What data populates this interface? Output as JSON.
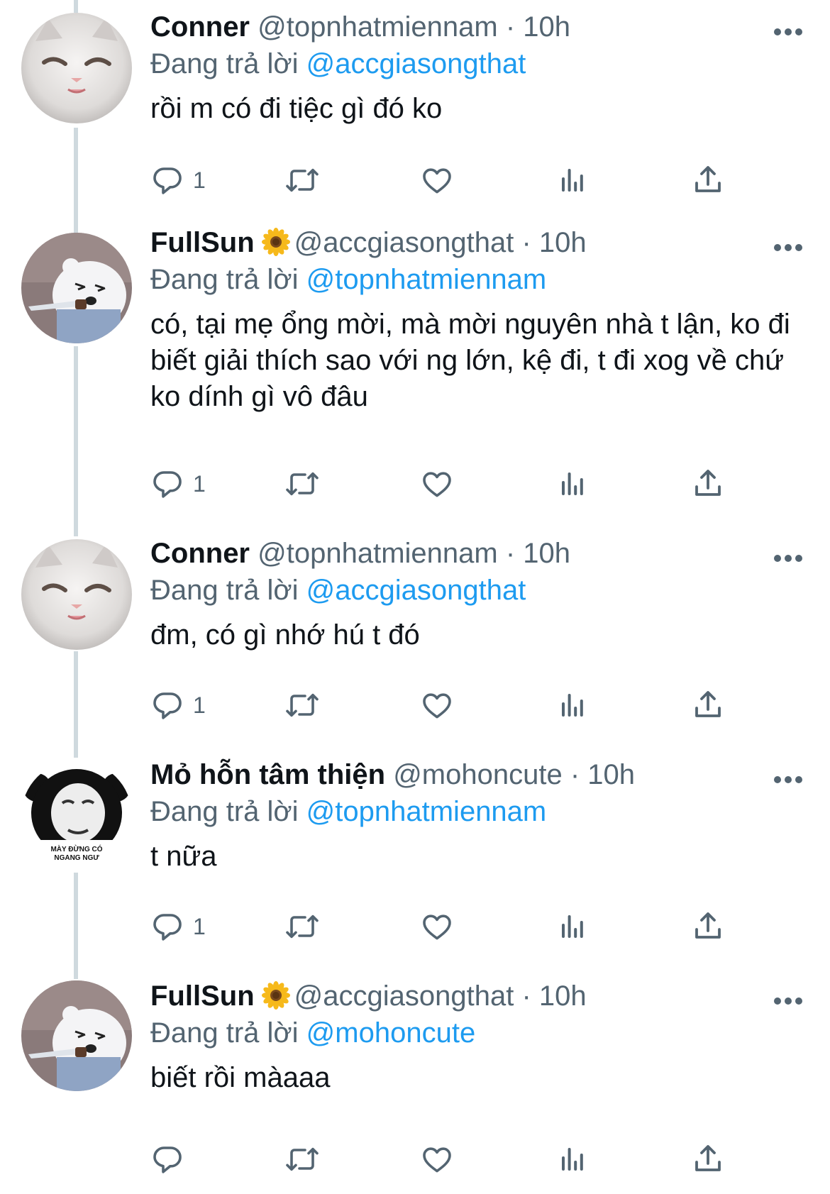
{
  "colors": {
    "text": "#0f1419",
    "secondary": "#536471",
    "accent": "#1d9bf0",
    "thread_line": "#cfd9de"
  },
  "tweets": [
    {
      "avatar": "white-cat-avatar",
      "name": "Conner",
      "handle": "@topnhatmiennam",
      "separator": "·",
      "time": "10h",
      "has_emoji": false,
      "replying_prefix": "Đang trả lời",
      "replying_to": "@accgiasongthat",
      "text": "rồi m có đi tiệc gì đó ko",
      "reply_count": "1"
    },
    {
      "avatar": "bear-knife-avatar",
      "name": "FullSun",
      "emoji": "sunflower-emoji",
      "handle": "@accgiasongthat",
      "separator": "·",
      "time": "10h",
      "has_emoji": true,
      "replying_prefix": "Đang trả lời",
      "replying_to": "@topnhatmiennam",
      "text": "có, tại mẹ ổng mời, mà mời nguyên nhà t lận, ko đi biết giải thích sao với ng lớn, kệ đi, t đi xog về chứ ko dính gì vô đâu",
      "reply_count": "1"
    },
    {
      "avatar": "white-cat-avatar",
      "name": "Conner",
      "handle": "@topnhatmiennam",
      "separator": "·",
      "time": "10h",
      "has_emoji": false,
      "replying_prefix": "Đang trả lời",
      "replying_to": "@accgiasongthat",
      "text": "đm, có gì nhớ hú t đó",
      "reply_count": "1"
    },
    {
      "avatar": "meme-face-avatar",
      "avatar_caption": [
        "MÀY ĐỪNG CÓ",
        "NGANG NGƯ"
      ],
      "name": "Mỏ hỗn tâm thiện",
      "handle": "@mohoncute",
      "separator": "·",
      "time": "10h",
      "has_emoji": false,
      "replying_prefix": "Đang trả lời",
      "replying_to": "@topnhatmiennam",
      "text": "t nữa",
      "reply_count": "1"
    },
    {
      "avatar": "bear-knife-avatar",
      "name": "FullSun",
      "emoji": "sunflower-emoji",
      "handle": "@accgiasongthat",
      "separator": "·",
      "time": "10h",
      "has_emoji": true,
      "replying_prefix": "Đang trả lời",
      "replying_to": "@mohoncute",
      "text": "biết rồi màaaa",
      "reply_count": ""
    }
  ]
}
